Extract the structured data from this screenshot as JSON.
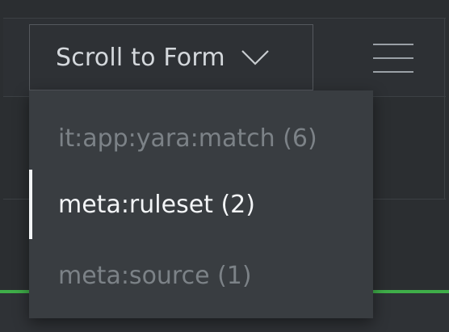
{
  "dropdown": {
    "label": "Scroll to Form"
  },
  "menu": {
    "items": [
      {
        "label": "it:app:yara:match (6)",
        "active": false
      },
      {
        "label": "meta:ruleset (2)",
        "active": true
      },
      {
        "label": "meta:source (1)",
        "active": false
      }
    ]
  },
  "colors": {
    "background": "#2b2e31",
    "menu_background": "#393d41",
    "active_text": "#f3f5f7",
    "inactive_text": "#7c8287",
    "accent_green": "#3fae49"
  },
  "icons": {
    "dropdown": "chevron-down-icon",
    "menu": "hamburger-menu-icon"
  }
}
